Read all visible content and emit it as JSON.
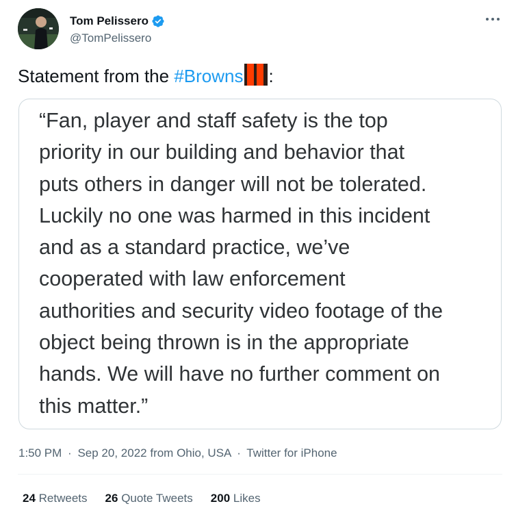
{
  "author": {
    "display_name": "Tom Pelissero",
    "handle": "@TomPelissero",
    "verified": true
  },
  "tweet": {
    "text_before": "Statement from the ",
    "hashtag": "#Browns",
    "emoji": "orange-brown-flag-icon",
    "text_after": ":"
  },
  "quote": {
    "text": "“Fan, player and staff safety is the top\npriority in our building and behavior that\nputs others in danger will not be tolerated.\nLuckily no one was harmed in this incident\nand as a standard practice, we’ve\ncooperated with law enforcement\nauthorities and security video footage of the\nobject being thrown is in the appropriate\nhands. We will have no further comment on\nthis matter.”"
  },
  "meta": {
    "time": "1:50 PM",
    "date": "Sep 20, 2022",
    "location": "from Ohio, USA",
    "client": "Twitter for iPhone",
    "separator": "·"
  },
  "stats": {
    "retweets_count": "24",
    "retweets_label": "Retweets",
    "quotes_count": "26",
    "quotes_label": "Quote Tweets",
    "likes_count": "200",
    "likes_label": "Likes"
  },
  "colors": {
    "link": "#1d9bf0",
    "verified": "#1d9bf0",
    "secondary_text": "#536471",
    "border": "#cfd9de"
  }
}
